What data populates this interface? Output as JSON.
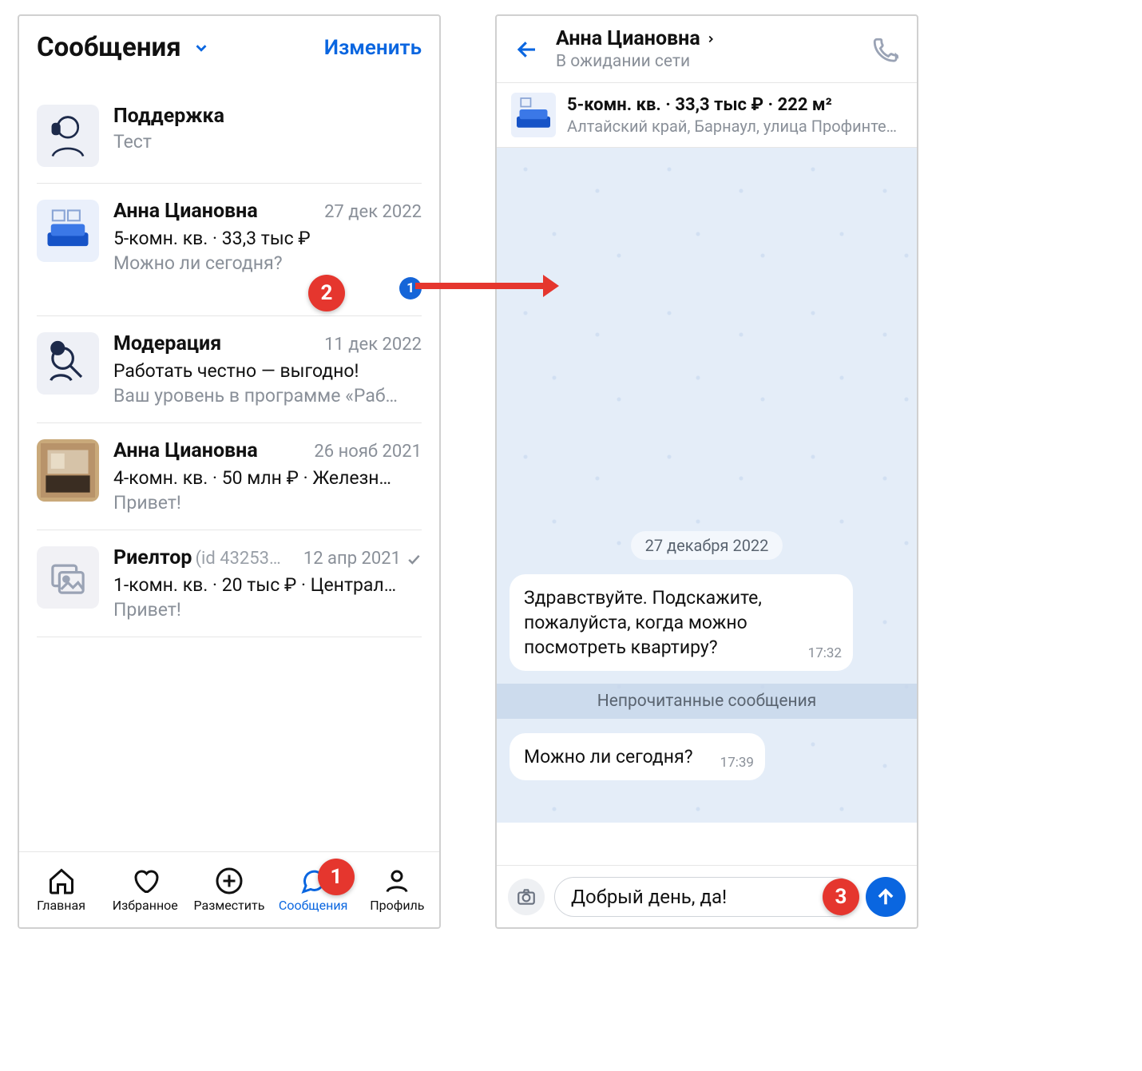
{
  "left": {
    "header": {
      "title": "Сообщения",
      "edit": "Изменить"
    },
    "items": [
      {
        "name": "Поддержка",
        "date": "",
        "sub": "",
        "preview": "Тест",
        "badge": ""
      },
      {
        "name": "Анна Циановна",
        "date": "27 дек 2022",
        "sub": "5-комн. кв. · 33,3 тыс ₽",
        "preview": "Можно ли сегодня?",
        "badge": "1"
      },
      {
        "name": "Модерация",
        "date": "11 дек 2022",
        "sub": "Работать честно — выгодно!",
        "preview": "Ваш уровень в программе «Раб…",
        "badge": ""
      },
      {
        "name": "Анна Циановна",
        "date": "26 нояб 2021",
        "sub": "4-комн. кв. · 50 млн ₽ · Железн…",
        "preview": "Привет!",
        "badge": ""
      },
      {
        "name": "Риелтор",
        "id": "(id 43253…",
        "date": "12 апр 2021",
        "sub": "1-комн. кв. · 20 тыс ₽ · Централ…",
        "preview": "Привет!",
        "badge": "",
        "check": true
      }
    ],
    "tabs": {
      "home": "Главная",
      "fav": "Избранное",
      "post": "Разместить",
      "msg": "Сообщения",
      "profile": "Профиль"
    }
  },
  "right": {
    "header": {
      "title": "Анна Циановна",
      "status": "В ожидании сети"
    },
    "listing": {
      "title": "5-комн. кв. · 33,3 тыс ₽ · 222 м²",
      "addr": "Алтайский край, Барнаул, улица Профинтерна, …"
    },
    "date_label": "27 декабря 2022",
    "msg1": {
      "text": "Здравствуйте. Подскажите, пожалуйста, когда можно посмотреть квартиру?",
      "time": "17:32"
    },
    "unread": "Непрочитанные сообщения",
    "msg2": {
      "text": "Можно ли сегодня?",
      "time": "17:39"
    },
    "compose": "Добрый день, да!"
  },
  "markers": {
    "m1": "1",
    "m2": "2",
    "m3": "3"
  }
}
